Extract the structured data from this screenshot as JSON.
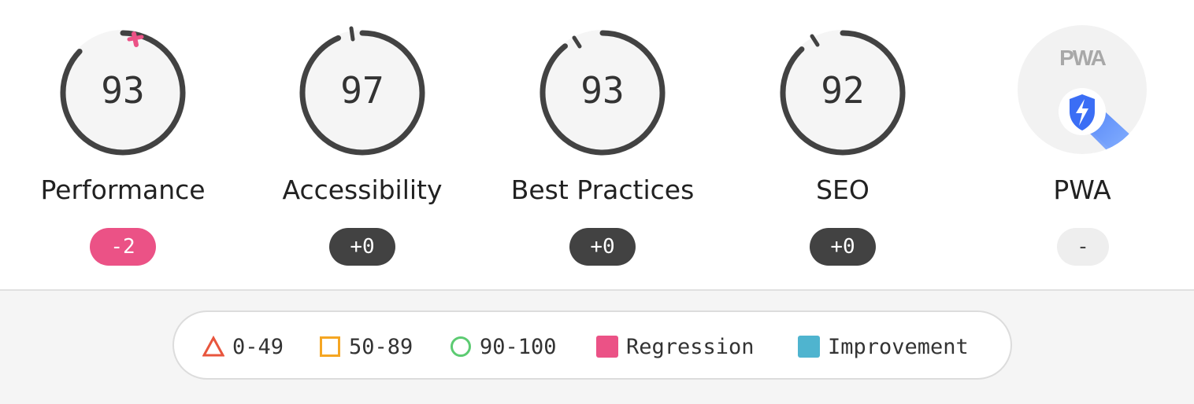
{
  "categories": [
    {
      "label": "Performance",
      "score": "93",
      "delta": "-2",
      "status": "regression"
    },
    {
      "label": "Accessibility",
      "score": "97",
      "delta": "+0",
      "status": "unchanged"
    },
    {
      "label": "Best Practices",
      "score": "93",
      "delta": "+0",
      "status": "unchanged"
    },
    {
      "label": "SEO",
      "score": "92",
      "delta": "+0",
      "status": "unchanged"
    },
    {
      "label": "PWA",
      "logo_text": "PWA",
      "delta": "-",
      "status": "none"
    }
  ],
  "legend": {
    "fail": "0-49",
    "average": "50-89",
    "pass": "90-100",
    "regression": "Regression",
    "improvement": "Improvement"
  },
  "colors": {
    "ring": "#424242",
    "regression": "#eb5286",
    "improvement": "#4fb4cf",
    "fail": "#e8553d",
    "average": "#f5a623",
    "pass": "#5ccb72",
    "pwa_badge": "#3b6ef5"
  },
  "icons": {
    "fail": "triangle-icon",
    "average": "square-icon",
    "pass": "circle-icon",
    "pwa": "pwa-lightning-badge-icon"
  }
}
